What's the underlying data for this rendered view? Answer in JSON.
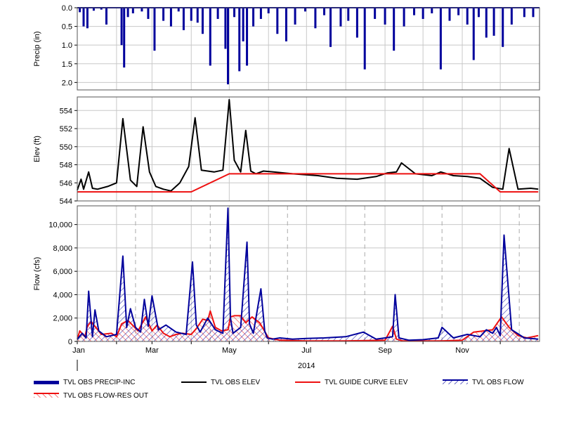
{
  "chart_data": [
    {
      "type": "bar",
      "ylabel": "Precip (in)",
      "ylim": [
        0.0,
        2.2
      ],
      "y_inverted": true,
      "yticks": [
        "0.0",
        "0.5",
        "1.0",
        "1.5",
        "2.0"
      ],
      "series": [
        {
          "name": "TVL OBS PRECIP-INC",
          "color": "#00009c",
          "x": [
            "2014-01-03",
            "2014-01-06",
            "2014-01-09",
            "2014-01-14",
            "2014-01-20",
            "2014-01-24",
            "2014-02-05",
            "2014-02-07",
            "2014-02-10",
            "2014-02-14",
            "2014-02-21",
            "2014-02-26",
            "2014-03-03",
            "2014-03-10",
            "2014-03-16",
            "2014-03-22",
            "2014-03-26",
            "2014-04-01",
            "2014-04-06",
            "2014-04-10",
            "2014-04-16",
            "2014-04-22",
            "2014-04-28",
            "2014-04-30",
            "2014-05-05",
            "2014-05-09",
            "2014-05-12",
            "2014-05-15",
            "2014-05-20",
            "2014-05-26",
            "2014-06-01",
            "2014-06-08",
            "2014-06-15",
            "2014-06-22",
            "2014-06-30",
            "2014-07-08",
            "2014-07-15",
            "2014-07-20",
            "2014-07-28",
            "2014-08-03",
            "2014-08-10",
            "2014-08-16",
            "2014-08-24",
            "2014-09-01",
            "2014-09-08",
            "2014-09-16",
            "2014-09-24",
            "2014-10-01",
            "2014-10-08",
            "2014-10-15",
            "2014-10-22",
            "2014-10-29",
            "2014-11-05",
            "2014-11-10",
            "2014-11-14",
            "2014-11-20",
            "2014-11-26",
            "2014-12-03",
            "2014-12-10",
            "2014-12-20",
            "2014-12-27"
          ],
          "values": [
            0.12,
            0.5,
            0.55,
            0.08,
            0.05,
            0.45,
            1.0,
            1.6,
            0.25,
            0.15,
            0.1,
            0.3,
            1.15,
            0.35,
            0.5,
            0.1,
            0.6,
            0.35,
            0.4,
            0.7,
            1.55,
            0.3,
            1.1,
            2.05,
            0.25,
            1.7,
            0.9,
            1.55,
            0.5,
            0.3,
            0.15,
            0.7,
            0.9,
            0.45,
            0.1,
            0.55,
            0.2,
            1.05,
            0.5,
            0.35,
            0.8,
            1.65,
            0.3,
            0.45,
            1.15,
            0.5,
            0.2,
            0.3,
            0.15,
            1.65,
            0.35,
            0.2,
            0.45,
            1.4,
            0.25,
            0.8,
            0.75,
            1.05,
            0.45,
            0.25,
            0.25
          ]
        }
      ]
    },
    {
      "type": "line",
      "ylabel": "Elev (ft)",
      "ylim": [
        544,
        555.5
      ],
      "yticks": [
        "544",
        "546",
        "548",
        "550",
        "552",
        "554"
      ],
      "series": [
        {
          "name": "TVL OBS ELEV",
          "color": "#000000",
          "x": [
            "2014-01-01",
            "2014-01-04",
            "2014-01-06",
            "2014-01-10",
            "2014-01-13",
            "2014-01-17",
            "2014-01-25",
            "2014-02-01",
            "2014-02-06",
            "2014-02-12",
            "2014-02-17",
            "2014-02-22",
            "2014-02-27",
            "2014-03-04",
            "2014-03-10",
            "2014-03-16",
            "2014-03-23",
            "2014-03-30",
            "2014-04-04",
            "2014-04-09",
            "2014-04-14",
            "2014-04-19",
            "2014-04-26",
            "2014-05-01",
            "2014-05-05",
            "2014-05-10",
            "2014-05-14",
            "2014-05-18",
            "2014-05-22",
            "2014-05-28",
            "2014-06-05",
            "2014-06-20",
            "2014-07-10",
            "2014-07-25",
            "2014-08-10",
            "2014-08-25",
            "2014-09-03",
            "2014-09-10",
            "2014-09-14",
            "2014-09-25",
            "2014-10-08",
            "2014-10-15",
            "2014-10-25",
            "2014-11-05",
            "2014-11-15",
            "2014-11-25",
            "2014-12-03",
            "2014-12-08",
            "2014-12-15",
            "2014-12-25",
            "2014-12-31"
          ],
          "values": [
            545.2,
            546.4,
            545.3,
            547.2,
            545.4,
            545.3,
            545.6,
            546.0,
            553.1,
            546.3,
            545.6,
            552.2,
            547.2,
            545.6,
            545.3,
            545.1,
            546.0,
            547.8,
            553.2,
            547.4,
            547.3,
            547.2,
            547.4,
            555.2,
            548.5,
            547.2,
            551.8,
            547.3,
            547.0,
            547.3,
            547.2,
            547.0,
            546.8,
            546.5,
            546.4,
            546.7,
            547.1,
            547.2,
            548.2,
            547.0,
            546.8,
            547.2,
            546.8,
            546.7,
            546.5,
            545.5,
            545.3,
            549.8,
            545.3,
            545.4,
            545.3
          ]
        },
        {
          "name": "TVL GUIDE CURVE ELEV",
          "color": "#ee1111",
          "x": [
            "2014-01-01",
            "2014-04-01",
            "2014-05-01",
            "2014-11-15",
            "2014-12-01",
            "2014-12-31"
          ],
          "values": [
            545.0,
            545.0,
            547.0,
            547.0,
            545.0,
            545.0
          ]
        }
      ]
    },
    {
      "type": "area",
      "xlabel": "2014",
      "xtick_labels": [
        "Jan",
        "Mar",
        "May",
        "Jul",
        "Sep",
        "Nov"
      ],
      "ylabel": "Flow (cfs)",
      "ylim": [
        0,
        11600
      ],
      "yticks": [
        "0",
        "2,000",
        "4,000",
        "6,000",
        "8,000",
        "10,000"
      ],
      "series": [
        {
          "name": "TVL OBS FLOW",
          "color": "#00009c",
          "x": [
            "2014-01-01",
            "2014-01-05",
            "2014-01-08",
            "2014-01-10",
            "2014-01-13",
            "2014-01-15",
            "2014-01-18",
            "2014-01-24",
            "2014-02-01",
            "2014-02-06",
            "2014-02-09",
            "2014-02-12",
            "2014-02-16",
            "2014-02-20",
            "2014-02-23",
            "2014-02-26",
            "2014-03-01",
            "2014-03-06",
            "2014-03-12",
            "2014-03-20",
            "2014-03-28",
            "2014-04-02",
            "2014-04-05",
            "2014-04-08",
            "2014-04-14",
            "2014-04-20",
            "2014-04-26",
            "2014-04-30",
            "2014-05-02",
            "2014-05-04",
            "2014-05-10",
            "2014-05-15",
            "2014-05-17",
            "2014-05-20",
            "2014-05-26",
            "2014-05-29",
            "2014-05-31",
            "2014-06-04",
            "2014-06-10",
            "2014-06-20",
            "2014-07-01",
            "2014-07-15",
            "2014-08-01",
            "2014-08-15",
            "2014-08-25",
            "2014-09-01",
            "2014-09-07",
            "2014-09-09",
            "2014-09-12",
            "2014-09-20",
            "2014-10-01",
            "2014-10-13",
            "2014-10-16",
            "2014-10-25",
            "2014-11-05",
            "2014-11-15",
            "2014-11-20",
            "2014-11-25",
            "2014-11-28",
            "2014-12-01",
            "2014-12-04",
            "2014-12-10",
            "2014-12-20",
            "2014-12-31"
          ],
          "values": [
            200,
            700,
            300,
            4300,
            400,
            2700,
            900,
            400,
            600,
            7300,
            1200,
            2800,
            1200,
            800,
            3600,
            1300,
            3900,
            1000,
            1400,
            800,
            600,
            6800,
            1400,
            800,
            2000,
            1000,
            700,
            11400,
            2000,
            700,
            1200,
            8500,
            1500,
            700,
            4500,
            900,
            300,
            200,
            300,
            200,
            250,
            300,
            400,
            800,
            200,
            300,
            400,
            4000,
            300,
            100,
            150,
            300,
            1200,
            300,
            600,
            400,
            1000,
            700,
            1200,
            500,
            9100,
            1000,
            300,
            200
          ]
        },
        {
          "name": "TVL OBS FLOW-RES OUT",
          "color": "#ee1111",
          "x": [
            "2014-01-01",
            "2014-01-03",
            "2014-01-07",
            "2014-01-09",
            "2014-01-12",
            "2014-01-20",
            "2014-01-28",
            "2014-02-01",
            "2014-02-05",
            "2014-02-10",
            "2014-02-18",
            "2014-02-24",
            "2014-03-01",
            "2014-03-05",
            "2014-03-10",
            "2014-03-15",
            "2014-03-20",
            "2014-03-25",
            "2014-04-01",
            "2014-04-05",
            "2014-04-10",
            "2014-04-14",
            "2014-04-16",
            "2014-04-20",
            "2014-04-25",
            "2014-04-30",
            "2014-05-02",
            "2014-05-05",
            "2014-05-10",
            "2014-05-14",
            "2014-05-19",
            "2014-05-25",
            "2014-06-01",
            "2014-06-10",
            "2014-07-01",
            "2014-08-01",
            "2014-09-01",
            "2014-09-07",
            "2014-09-10",
            "2014-09-15",
            "2014-10-01",
            "2014-10-15",
            "2014-11-01",
            "2014-11-10",
            "2014-11-18",
            "2014-11-25",
            "2014-12-02",
            "2014-12-08",
            "2014-12-15",
            "2014-12-22",
            "2014-12-31"
          ],
          "values": [
            200,
            900,
            400,
            1300,
            1700,
            600,
            700,
            400,
            1500,
            1800,
            900,
            2100,
            900,
            1400,
            700,
            400,
            600,
            700,
            600,
            1100,
            1900,
            1800,
            2600,
            1200,
            900,
            1000,
            2100,
            2200,
            2200,
            1600,
            2100,
            1600,
            300,
            100,
            50,
            50,
            100,
            1300,
            200,
            50,
            50,
            50,
            100,
            800,
            900,
            1000,
            2100,
            1200,
            500,
            300,
            500
          ]
        }
      ]
    }
  ],
  "legend": [
    {
      "label": "TVL OBS PRECIP-INC",
      "color": "#00009c",
      "style": "thick"
    },
    {
      "label": "TVL OBS ELEV",
      "color": "#000000",
      "style": "line"
    },
    {
      "label": "TVL GUIDE CURVE ELEV",
      "color": "#ee1111",
      "style": "line"
    },
    {
      "label": "TVL OBS FLOW",
      "color": "#00009c",
      "style": "hatch"
    },
    {
      "label": "TVL OBS FLOW-RES OUT",
      "color": "#ee1111",
      "style": "hatch"
    }
  ]
}
